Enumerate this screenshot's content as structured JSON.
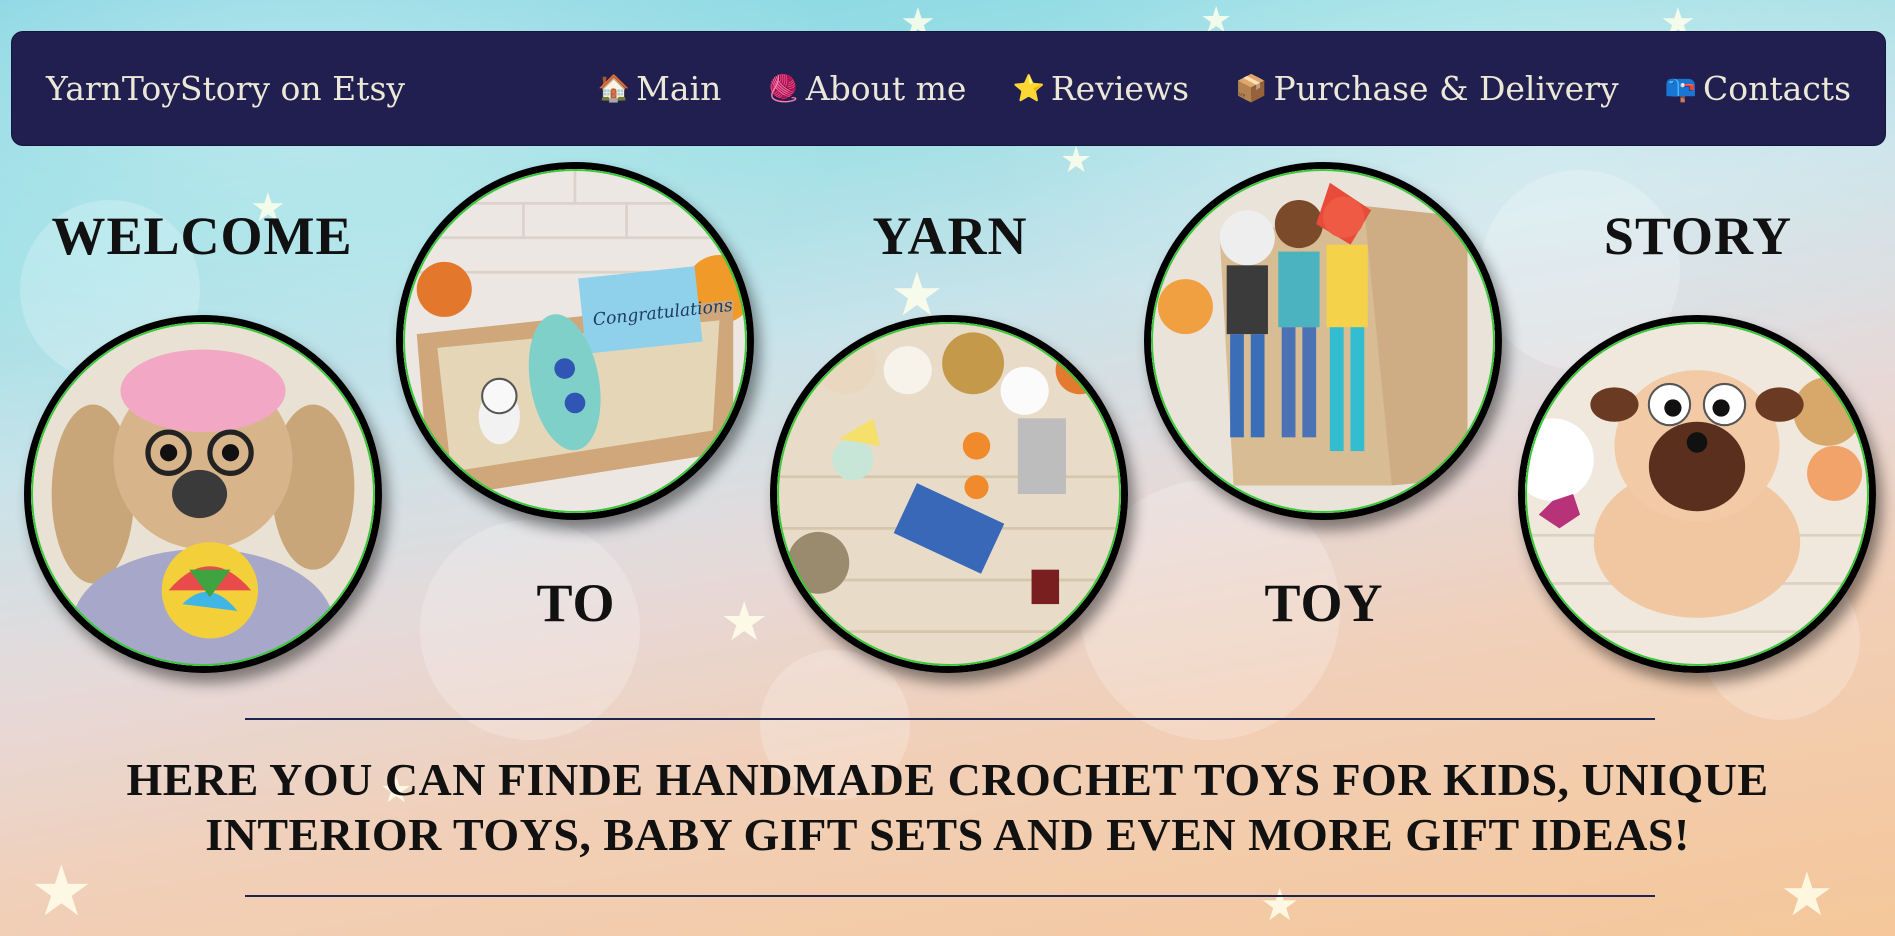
{
  "header": {
    "brand": "YarnToyStory on Etsy",
    "nav": [
      {
        "icon": "house-icon",
        "glyph": "🏠",
        "label": "Main"
      },
      {
        "icon": "yarn-ball-icon",
        "glyph": "🧶",
        "label": "About me"
      },
      {
        "icon": "star-icon",
        "glyph": "⭐",
        "label": "Reviews"
      },
      {
        "icon": "package-icon",
        "glyph": "📦",
        "label": "Purchase & Delivery"
      },
      {
        "icon": "mailbox-icon",
        "glyph": "📪",
        "label": "Contacts"
      }
    ]
  },
  "hero": {
    "words": [
      "WELCOME",
      "TO",
      "YARN",
      "TOY",
      "STORY"
    ]
  },
  "tagline": "HERE YOU CAN FINDE HANDMADE CROCHET TOYS FOR KIDS, UNIQUE INTERIOR TOYS, BABY GIFT SETS AND EVEN MORE GIFT IDEAS!",
  "gift_card_text": "Congratulations",
  "colors": {
    "navbar_bg": "#211f4f",
    "nav_text": "#ece8d8",
    "photo_border": "#000000",
    "photo_inner_ring": "#38c838"
  }
}
